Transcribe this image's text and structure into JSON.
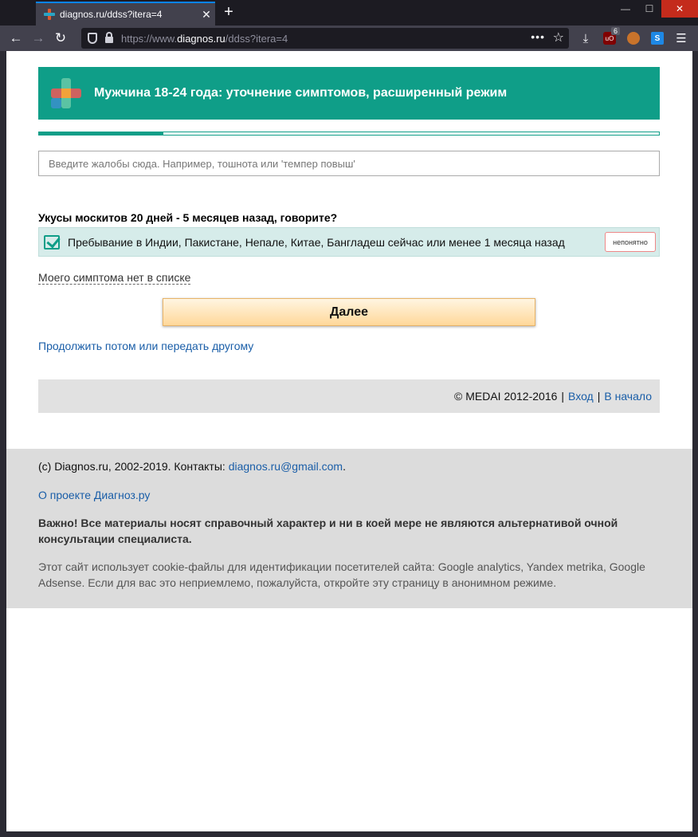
{
  "browser": {
    "tab_title": "diagnos.ru/ddss?itera=4",
    "url_prefix": "https://www.",
    "url_domain": "diagnos.ru",
    "url_path": "/ddss?itera=4",
    "ublock_badge": "6"
  },
  "header": {
    "title": "Мужчина 18-24 года: уточнение симптомов, расширенный режим"
  },
  "progress": {
    "fraction": 0.2
  },
  "search": {
    "placeholder": "Введите жалобы сюда. Например, тошнота или 'темпер повыш'"
  },
  "question": {
    "text": "Укусы москитов 20 дней - 5 месяцев назад, говорите?",
    "answer": "Пребывание в Индии, Пакистане, Непале, Китае, Бангладеш сейчас или менее 1 месяца назад",
    "unsure_label": "непонятно"
  },
  "actions": {
    "no_symptom": "Моего симптома нет в списке",
    "next_label": "Далее",
    "continue_later": "Продолжить потом или передать другому"
  },
  "footer1": {
    "copyright": "© MEDAI 2012-2016",
    "sep": "|",
    "login": "Вход",
    "home": "В начало"
  },
  "footer2": {
    "contacts_prefix": "(c) Diagnos.ru, 2002-2019. Контакты: ",
    "email": "diagnos.ru@gmail.com",
    "contacts_suffix": ".",
    "about": "О проекте Диагноз.ру",
    "warning": "Важно! Все материалы носят справочный характер и ни в коей мере не являются альтернативой очной консультации специалиста.",
    "cookie": "Этот сайт использует cookie-файлы для идентификации посетителей сайта: Google analytics, Yandex metrika, Google Adsense. Если для вас это неприемлемо, пожалуйста, откройте эту страницу в анонимном режиме."
  },
  "colors": {
    "brand": "#0f9e88",
    "link": "#1a5ea8",
    "answer_bg": "#d6ecea"
  }
}
